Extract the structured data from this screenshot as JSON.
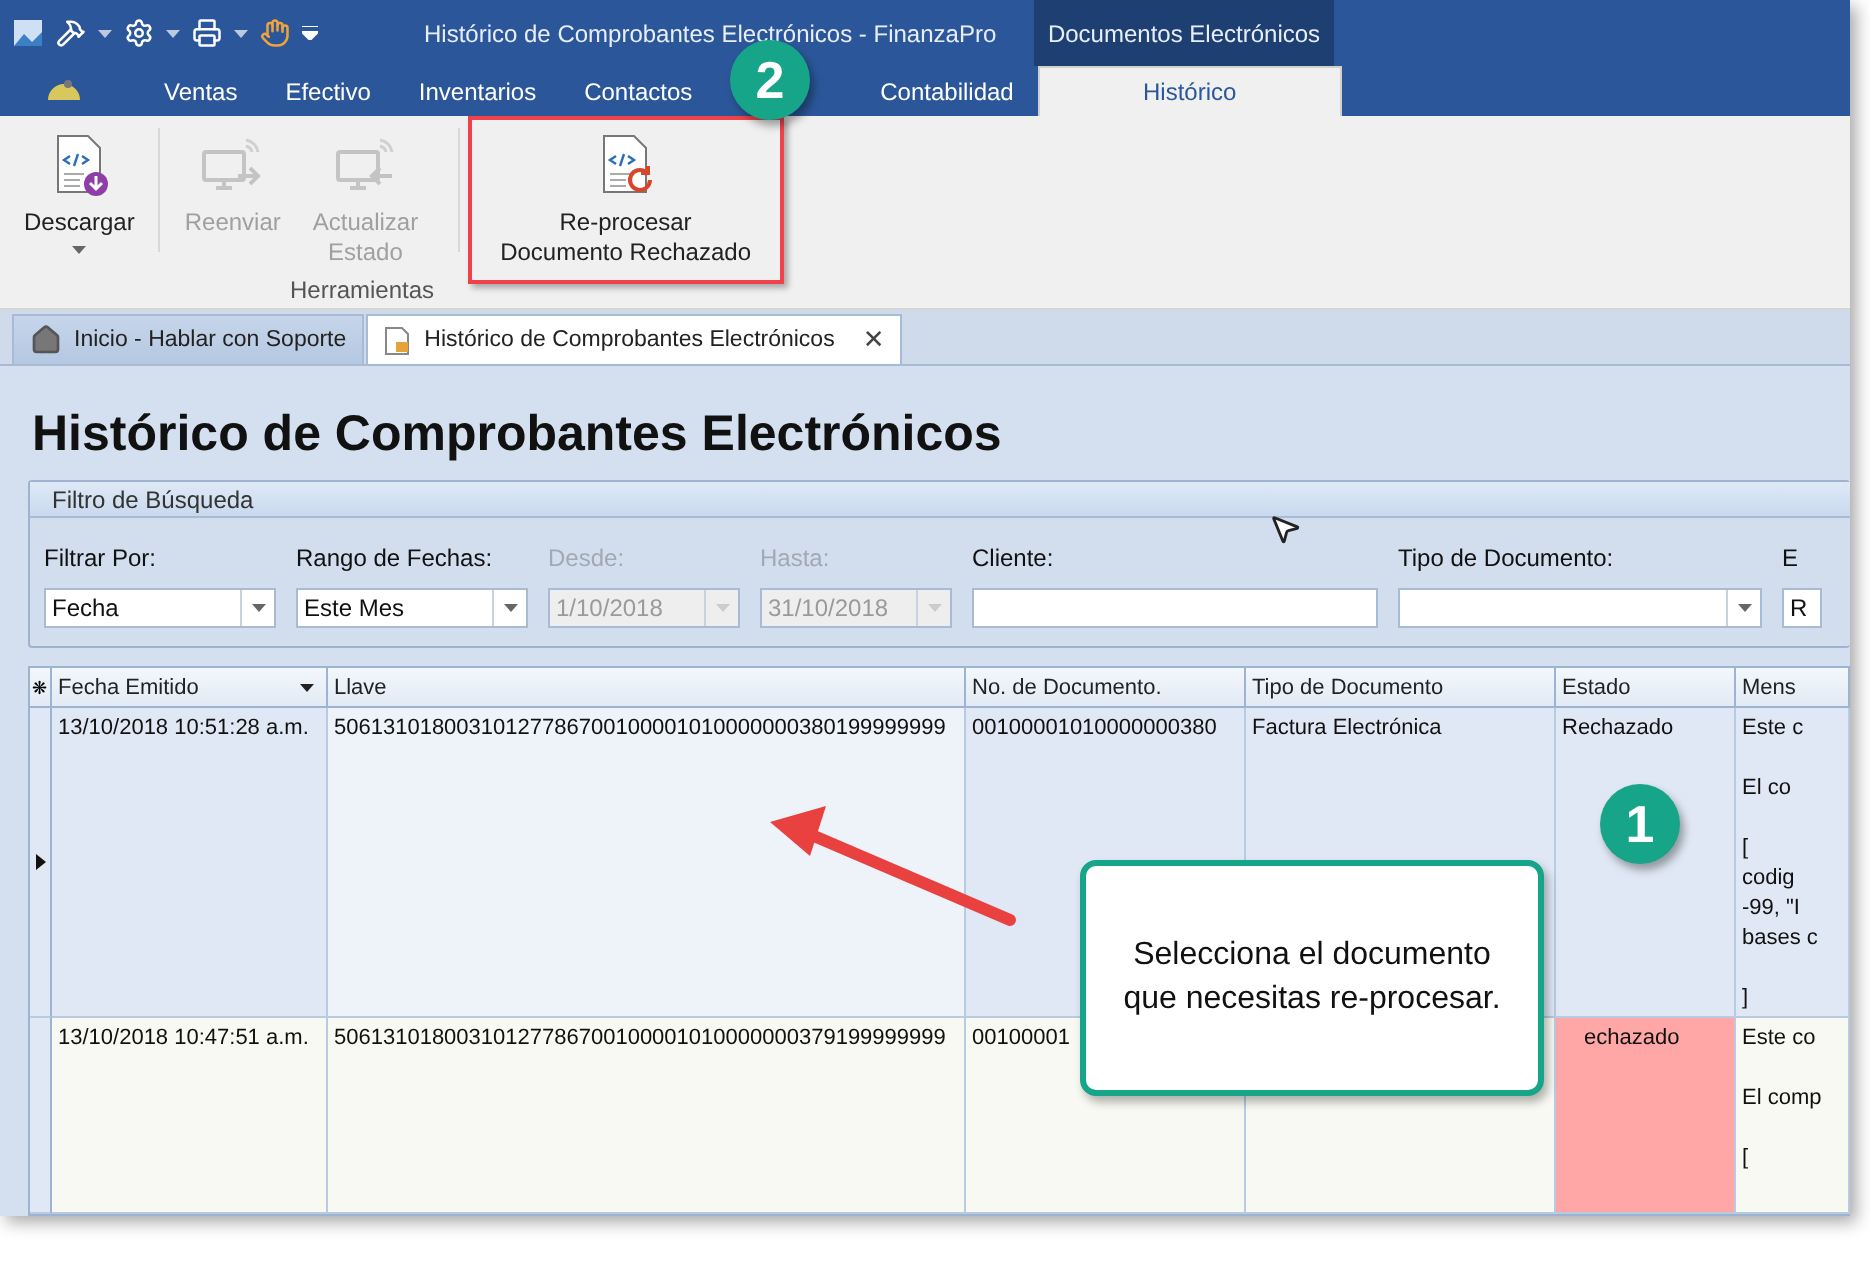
{
  "window": {
    "title": "Histórico de Comprobantes Electrónicos - FinanzaPro",
    "context_group": "Documentos Electrónicos"
  },
  "ribbon_tabs": [
    {
      "label": "Ventas",
      "selected": false
    },
    {
      "label": "Efectivo",
      "selected": false
    },
    {
      "label": "Inventarios",
      "selected": false
    },
    {
      "label": "Contactos",
      "selected": false
    },
    {
      "label": "Contabilidad",
      "selected": false
    },
    {
      "label": "Histórico",
      "selected": true
    }
  ],
  "ribbon": {
    "group": "Herramientas",
    "buttons": [
      {
        "kind": "download",
        "label": "Descargar",
        "disabled": false,
        "dropdown": true,
        "highlighted": false
      },
      {
        "kind": "send",
        "label": "Reenviar",
        "disabled": true,
        "dropdown": false,
        "highlighted": false
      },
      {
        "kind": "update",
        "label": "Actualizar\nEstado",
        "disabled": true,
        "dropdown": false,
        "highlighted": false
      },
      {
        "kind": "reprocess",
        "label": "Re-procesar\nDocumento Rechazado",
        "disabled": false,
        "dropdown": false,
        "highlighted": true
      }
    ]
  },
  "doc_tabs": [
    {
      "kind": "home",
      "label": "Inicio - Hablar con Soporte",
      "selected": false,
      "closable": false
    },
    {
      "kind": "document",
      "label": "Histórico de Comprobantes Electrónicos",
      "selected": true,
      "closable": true
    }
  ],
  "close_glyph": "✕",
  "page_title": "Histórico de Comprobantes Electrónicos",
  "filter": {
    "title": "Filtro de Búsqueda",
    "fields": [
      {
        "kind": "combo",
        "label": "Filtrar Por:",
        "value": "Fecha",
        "disabled": false
      },
      {
        "kind": "combo",
        "label": "Rango de Fechas:",
        "value": "Este Mes",
        "disabled": false
      },
      {
        "kind": "combo",
        "label": "Desde:",
        "value": "1/10/2018",
        "disabled": true
      },
      {
        "kind": "combo",
        "label": "Hasta:",
        "value": "31/10/2018",
        "disabled": true
      },
      {
        "kind": "text",
        "label": "Cliente:",
        "disabled": false
      },
      {
        "kind": "combo",
        "label": "Tipo de Documento:",
        "disabled": false
      },
      {
        "kind": "text",
        "label": "E",
        "value": "R",
        "disabled": false
      }
    ]
  },
  "grid": {
    "corner_glyph": "❋",
    "columns": [
      "Fecha Emitido",
      "Llave",
      "No. de Documento.",
      "Tipo de Documento",
      "Estado",
      "Mens"
    ],
    "rows": [
      {
        "selected": true,
        "estado_highlight": false,
        "cells": [
          "13/10/2018 10:51:28 a.m.",
          "50613101800310127786700100001010000000380199999999",
          "00100001010000000380",
          "Factura Electrónica",
          "Rechazado",
          "Este c\n\nEl co\n\n[\ncodig\n-99, \"I\nbases c\n\n]"
        ]
      },
      {
        "selected": false,
        "estado_highlight": true,
        "cells": [
          "13/10/2018 10:47:51 a.m.",
          "50613101800310127786700100001010000000379199999999",
          "00100001",
          null,
          "echazado",
          "Este co\n\nEl comp\n\n["
        ]
      }
    ]
  },
  "annotations": {
    "step_badges": [
      "2",
      "1"
    ],
    "callout": "Selecciona el documento\nque necesitas re-procesar."
  }
}
